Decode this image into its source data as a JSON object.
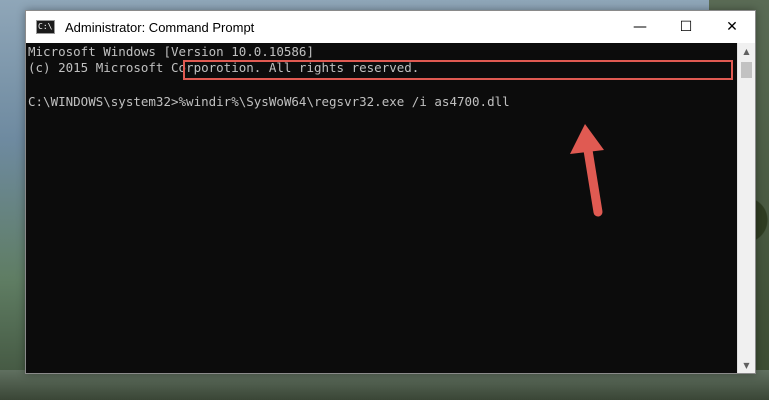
{
  "window": {
    "title": "Administrator: Command Prompt",
    "icon_label": "C:\\"
  },
  "controls": {
    "minimize": "—",
    "maximize": "☐",
    "close": "✕"
  },
  "console": {
    "line1": "Microsoft Windows [Version 10.0.10586]",
    "line2": "(c) 2015 Microsoft Corporotion. All rights reserved.",
    "prompt": "C:\\WINDOWS\\system32>",
    "command": "%windir%\\SysWoW64\\regsvr32.exe /i as4700.dll"
  },
  "colors": {
    "highlight": "#e05a52",
    "arrow": "#e05a52",
    "console_bg": "#0c0c0c",
    "console_text": "#c0c0c0"
  }
}
